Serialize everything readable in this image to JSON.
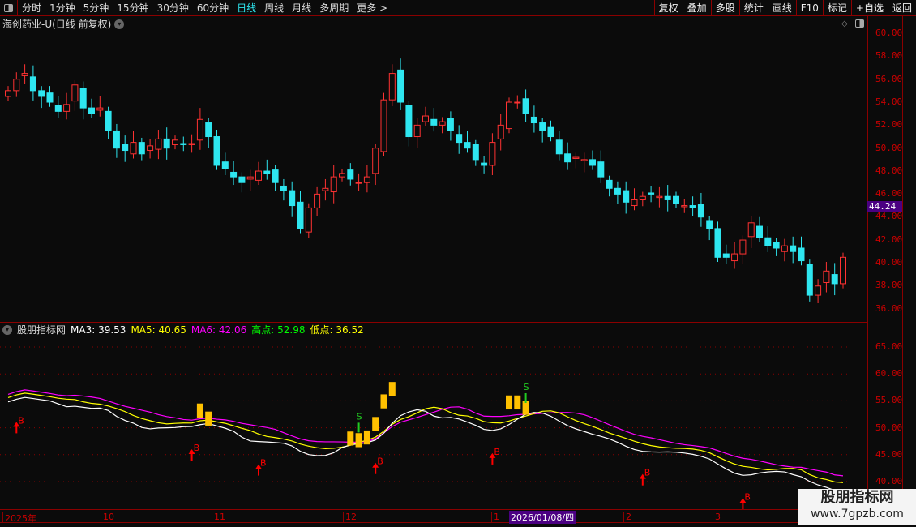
{
  "toolbar": {
    "periods": [
      "分时",
      "1分钟",
      "5分钟",
      "15分钟",
      "30分钟",
      "60分钟",
      "日线",
      "周线",
      "月线",
      "多周期",
      "更多 >"
    ],
    "active": "日线",
    "right_buttons": [
      "复权",
      "叠加",
      "多股",
      "统计",
      "画线",
      "F10",
      "标记",
      "+自选",
      "返回"
    ]
  },
  "title": "海创药业-U(日线 前复权)",
  "price_axis": {
    "ticks": [
      "60.00",
      "58.00",
      "56.00",
      "54.00",
      "52.00",
      "50.00",
      "48.00",
      "46.00",
      "44.00",
      "42.00",
      "40.00",
      "38.00",
      "36.00"
    ],
    "current": "44.24"
  },
  "indicator": {
    "name": "股朋指标网",
    "ma3_label": "MA3: 39.53",
    "ma5_label": "MA5: 40.65",
    "ma6_label": "MA6: 42.06",
    "high_label": "高点: 52.98",
    "low_label": "低点: 36.52",
    "ticks": [
      "65.00",
      "60.00",
      "55.00",
      "50.00",
      "45.00",
      "40.00"
    ]
  },
  "date_axis": {
    "labels": [
      "2025年",
      "10",
      "11",
      "12",
      "1",
      "2",
      "3"
    ],
    "highlight": "2026/01/08/四"
  },
  "watermark": {
    "name": "股朋指标网",
    "url": "www.7gpzb.com"
  },
  "colors": {
    "up": "#ff3232",
    "down": "#2ee6f0",
    "ma3": "#ffffff",
    "ma5": "#ffff00",
    "ma6": "#ff00ff",
    "signal": "#ffc000"
  },
  "chart_data": {
    "type": "candlestick",
    "ylim": [
      35,
      61
    ],
    "indicator_ylim": [
      38,
      68
    ],
    "closes": [
      55,
      56,
      56.5,
      55,
      54.5,
      54,
      53.2,
      53.8,
      55.5,
      53.5,
      53,
      53.5,
      51.5,
      50,
      49.8,
      50.5,
      49.5,
      50.2,
      50.8,
      50,
      50.7,
      50.3,
      50.4,
      52.5,
      51,
      48.5,
      48.2,
      47.5,
      47,
      47.5,
      48,
      47.8,
      47,
      46.3,
      45,
      43,
      44.8,
      46,
      46.5,
      47.5,
      47.8,
      47.3,
      47,
      47.5,
      50,
      54.2,
      56.5,
      54,
      51,
      52,
      52.8,
      52,
      52.3,
      51.5,
      50.5,
      50,
      49,
      48.5,
      50.5,
      52,
      54,
      54,
      53,
      52.2,
      51.5,
      51,
      49.5,
      48.8,
      49.2,
      49,
      48.5,
      47.5,
      46.5,
      46,
      45.3,
      45.5,
      45.8,
      46,
      45.8,
      45.5,
      45.2,
      45,
      44.8,
      44,
      43,
      40.5,
      40.5,
      40.8,
      42,
      43.5,
      42.2,
      41.5,
      41.3,
      41.5,
      41,
      40.2,
      37.2,
      38,
      39.3,
      38.2,
      40.5
    ],
    "buy_signals": [
      1,
      22,
      30,
      44,
      58,
      76,
      88
    ],
    "sell_signals": [
      42,
      62
    ],
    "signal_bars": [
      23,
      24,
      41,
      42,
      43,
      44,
      45,
      46,
      60,
      61,
      62
    ]
  }
}
